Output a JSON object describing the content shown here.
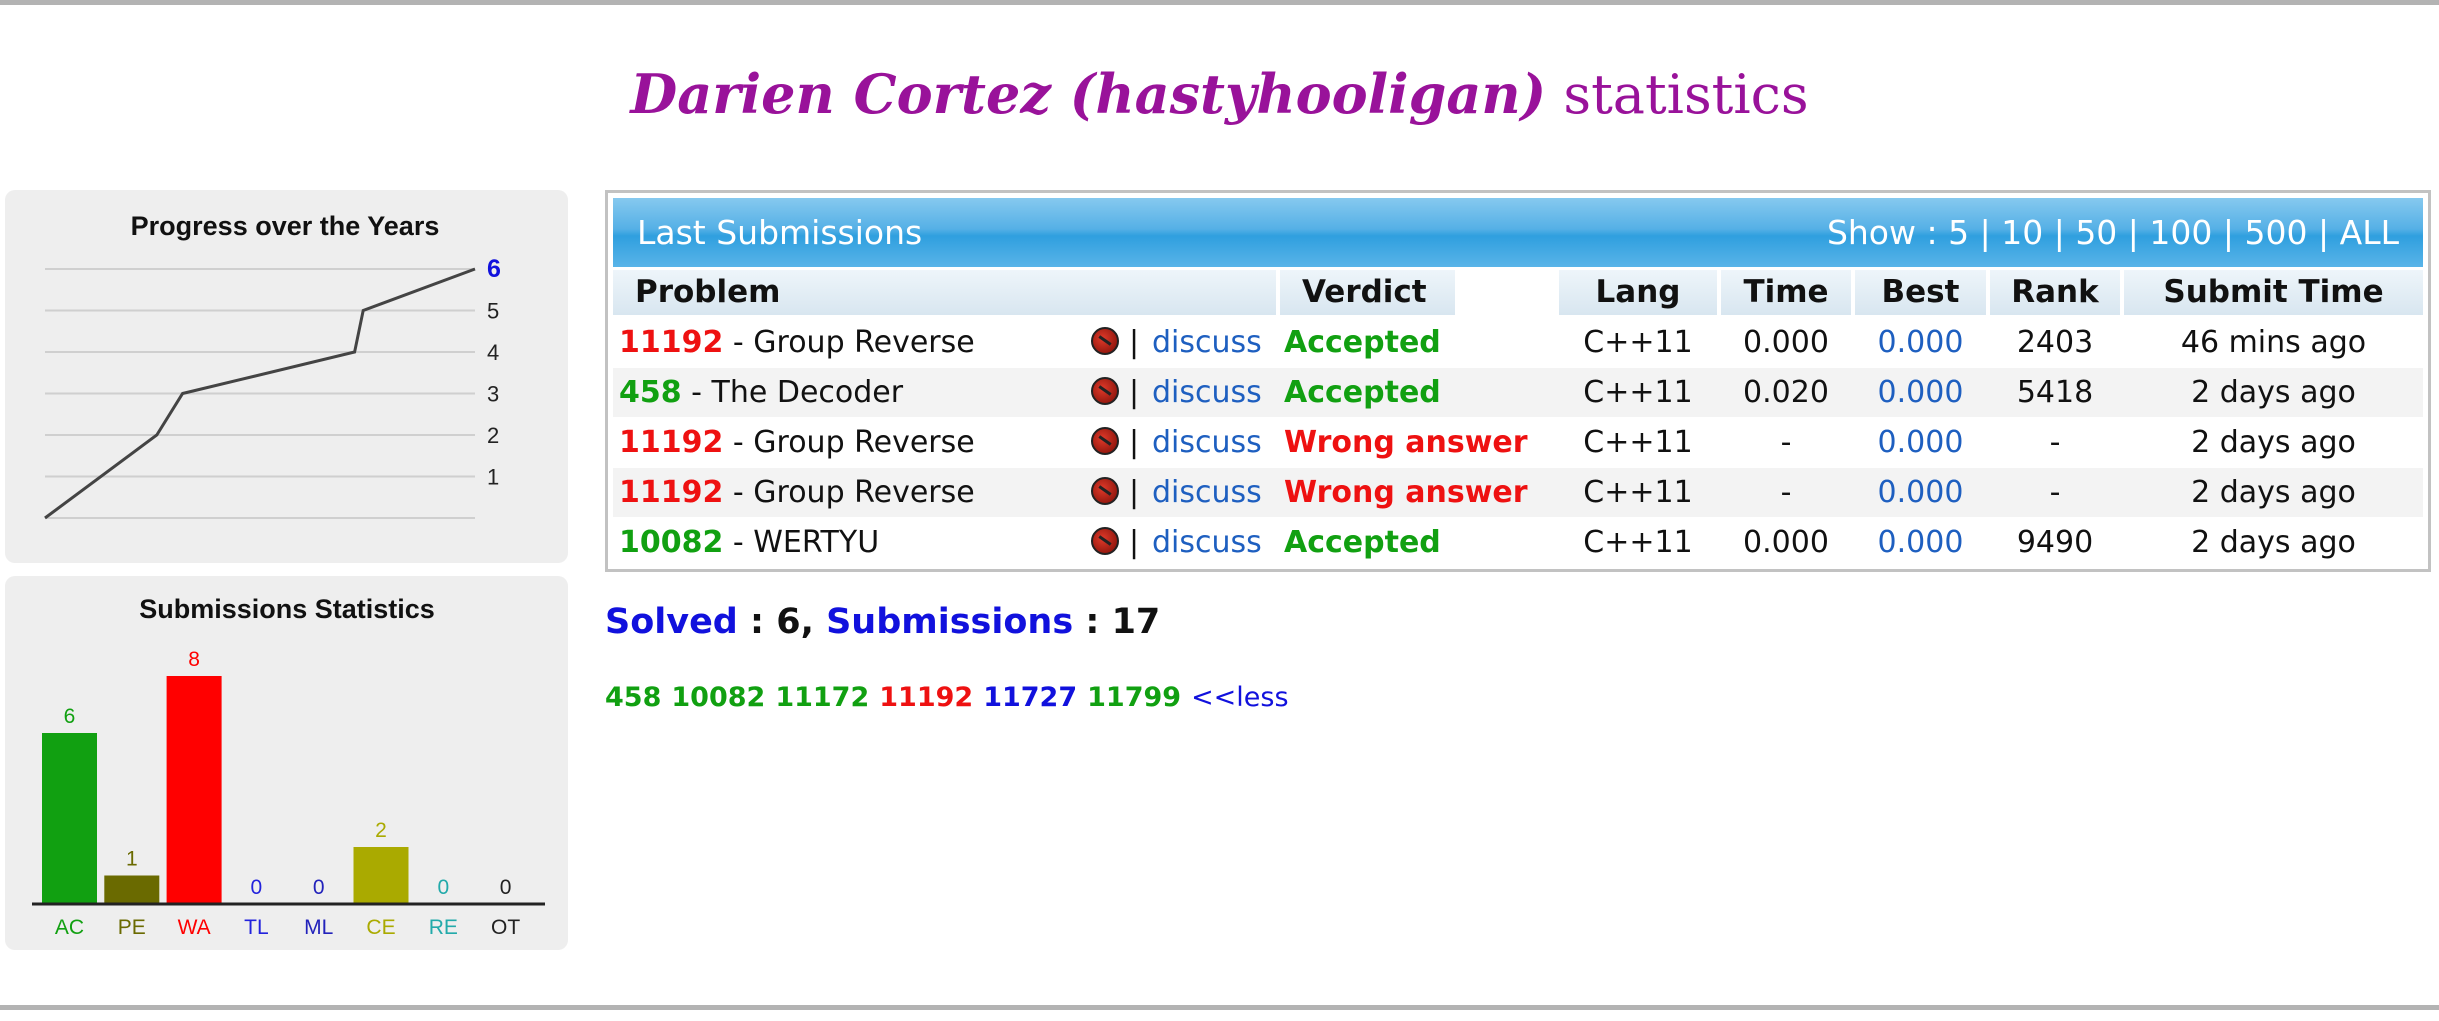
{
  "page": {
    "user_name": "Darien Cortez (hastyhooligan)",
    "title_suffix": "statistics"
  },
  "colors": {
    "title": "#99129a",
    "red": "#ee1111",
    "green": "#11a011",
    "blue": "#1111dd",
    "link": "#1e5fc0",
    "header_blue": "#3aa6e2"
  },
  "progress_chart": {
    "title": "Progress over the Years",
    "y_ticks": [
      "1",
      "2",
      "3",
      "4",
      "5",
      "6"
    ],
    "chart_data": {
      "type": "line",
      "title": "Progress over the Years",
      "ylim": [
        0,
        6
      ],
      "points": [
        [
          0,
          0
        ],
        [
          0.26,
          2
        ],
        [
          0.32,
          3
        ],
        [
          0.72,
          4
        ],
        [
          0.74,
          5
        ],
        [
          1.0,
          6
        ]
      ],
      "highlight_value": "6"
    }
  },
  "submissions_chart": {
    "title": "Submissions Statistics",
    "chart_data": {
      "type": "bar",
      "title": "Submissions Statistics",
      "categories": [
        "AC",
        "PE",
        "WA",
        "TL",
        "ML",
        "CE",
        "RE",
        "OT"
      ],
      "values": [
        6,
        1,
        8,
        0,
        0,
        2,
        0,
        0
      ],
      "colors": [
        "#11a011",
        "#6a6a00",
        "#ff0000",
        "#2222dd",
        "#2222bb",
        "#aaaa00",
        "#22aaaa",
        "#222222"
      ],
      "ylim": [
        0,
        8
      ]
    }
  },
  "last_submissions": {
    "title": "Last Submissions",
    "show_label": "Show :",
    "show_options": [
      "5",
      "10",
      "50",
      "100",
      "500",
      "ALL"
    ],
    "columns": [
      "Problem",
      "Verdict",
      "Lang",
      "Time",
      "Best",
      "Rank",
      "Submit Time"
    ],
    "discuss_label": "discuss",
    "rows": [
      {
        "num": "11192",
        "num_color": "red",
        "name": "- Group Reverse",
        "verdict": "Accepted",
        "verdict_type": "ok",
        "lang": "C++11",
        "time": "0.000",
        "best": "0.000",
        "rank": "2403",
        "submit": "46 mins ago"
      },
      {
        "num": "458",
        "num_color": "green",
        "name": "- The Decoder",
        "verdict": "Accepted",
        "verdict_type": "ok",
        "lang": "C++11",
        "time": "0.020",
        "best": "0.000",
        "rank": "5418",
        "submit": "2 days ago"
      },
      {
        "num": "11192",
        "num_color": "red",
        "name": "- Group Reverse",
        "verdict": "Wrong answer",
        "verdict_type": "wa",
        "lang": "C++11",
        "time": "-",
        "best": "0.000",
        "rank": "-",
        "submit": "2 days ago"
      },
      {
        "num": "11192",
        "num_color": "red",
        "name": "- Group Reverse",
        "verdict": "Wrong answer",
        "verdict_type": "wa",
        "lang": "C++11",
        "time": "-",
        "best": "0.000",
        "rank": "-",
        "submit": "2 days ago"
      },
      {
        "num": "10082",
        "num_color": "green",
        "name": "- WERTYU",
        "verdict": "Accepted",
        "verdict_type": "ok",
        "lang": "C++11",
        "time": "0.000",
        "best": "0.000",
        "rank": "9490",
        "submit": "2 days ago"
      }
    ]
  },
  "totals": {
    "solved_label": "Solved",
    "solved": "6",
    "submissions_label": "Submissions",
    "submissions": "17"
  },
  "solved_problems": [
    {
      "num": "458",
      "color": "green"
    },
    {
      "num": "10082",
      "color": "green"
    },
    {
      "num": "11172",
      "color": "green"
    },
    {
      "num": "11192",
      "color": "red"
    },
    {
      "num": "11727",
      "color": "blue"
    },
    {
      "num": "11799",
      "color": "green"
    }
  ],
  "less_link": "<<less"
}
